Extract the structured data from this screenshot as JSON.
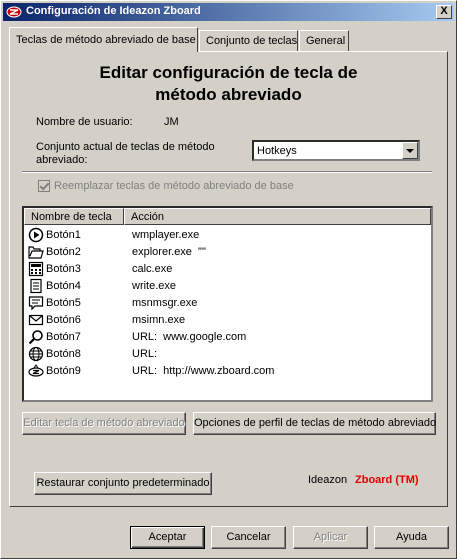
{
  "window": {
    "title": "Configuración de Ideazon Zboard",
    "close_label": "X"
  },
  "tabs": [
    {
      "label": "Teclas de método abreviado de base",
      "active": true
    },
    {
      "label": "Conjunto de teclas",
      "active": false
    },
    {
      "label": "General",
      "active": false
    }
  ],
  "panel": {
    "heading_line1": "Editar configuración de tecla de",
    "heading_line2": "método abreviado",
    "username_label": "Nombre de usuario:",
    "username_value": "JM",
    "set_label_line1": "Conjunto actual de teclas de método",
    "set_label_line2": "abreviado:",
    "set_value": "Hotkeys",
    "replace_checkbox_label": "Reemplazar teclas de método abreviado de base",
    "replace_checked": true,
    "replace_enabled": false
  },
  "list": {
    "columns": [
      "Nombre de tecla",
      "Acción"
    ],
    "rows": [
      {
        "name": "Botón1",
        "action": "wmplayer.exe",
        "icon": "play-icon"
      },
      {
        "name": "Botón2",
        "action": "explorer.exe  \"\"",
        "icon": "folder-icon"
      },
      {
        "name": "Botón3",
        "action": "calc.exe",
        "icon": "calculator-icon"
      },
      {
        "name": "Botón4",
        "action": "write.exe",
        "icon": "document-icon"
      },
      {
        "name": "Botón5",
        "action": "msnmsgr.exe",
        "icon": "chat-icon"
      },
      {
        "name": "Botón6",
        "action": "msimn.exe",
        "icon": "mail-icon"
      },
      {
        "name": "Botón7",
        "action": "URL:  www.google.com",
        "icon": "search-icon"
      },
      {
        "name": "Botón8",
        "action": "URL:",
        "icon": "globe-icon"
      },
      {
        "name": "Botón9",
        "action": "URL:  http://www.zboard.com",
        "icon": "zboard-icon"
      }
    ]
  },
  "buttons": {
    "edit_hotkey": "Editar tecla de método abreviado",
    "profile_options": "Opciones de perfil de teclas de método abreviado",
    "restore_default": "Restaurar conjunto predeterminado",
    "ok": "Aceptar",
    "cancel": "Cancelar",
    "apply": "Aplicar",
    "help": "Ayuda"
  },
  "brand": {
    "company": "Ideazon",
    "product": "Zboard (TM)",
    "product_color": "#e00000"
  }
}
